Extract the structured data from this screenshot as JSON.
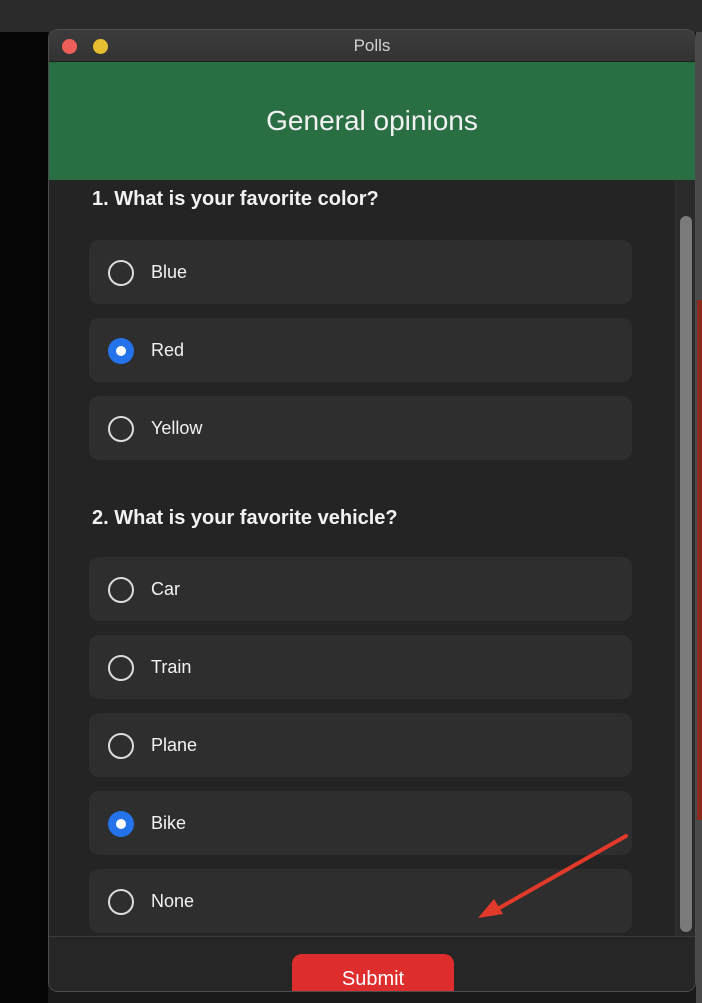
{
  "window": {
    "title": "Polls"
  },
  "poll": {
    "title": "General opinions",
    "questions": [
      {
        "text": "1. What is your favorite color?",
        "options": [
          {
            "label": "Blue",
            "selected": false
          },
          {
            "label": "Red",
            "selected": true
          },
          {
            "label": "Yellow",
            "selected": false
          }
        ]
      },
      {
        "text": "2. What is your favorite vehicle?",
        "options": [
          {
            "label": "Car",
            "selected": false
          },
          {
            "label": "Train",
            "selected": false
          },
          {
            "label": "Plane",
            "selected": false
          },
          {
            "label": "Bike",
            "selected": true
          },
          {
            "label": "None",
            "selected": false
          }
        ]
      }
    ]
  },
  "footer": {
    "submit_label": "Submit"
  },
  "colors": {
    "header_green": "#2a6e43",
    "submit_red": "#de2d2d",
    "radio_blue": "#2473ea",
    "arrow_red": "#e23a2a"
  },
  "icons": {
    "close": "close-icon",
    "minimize": "minimize-icon",
    "annotation": "red-arrow-icon"
  }
}
